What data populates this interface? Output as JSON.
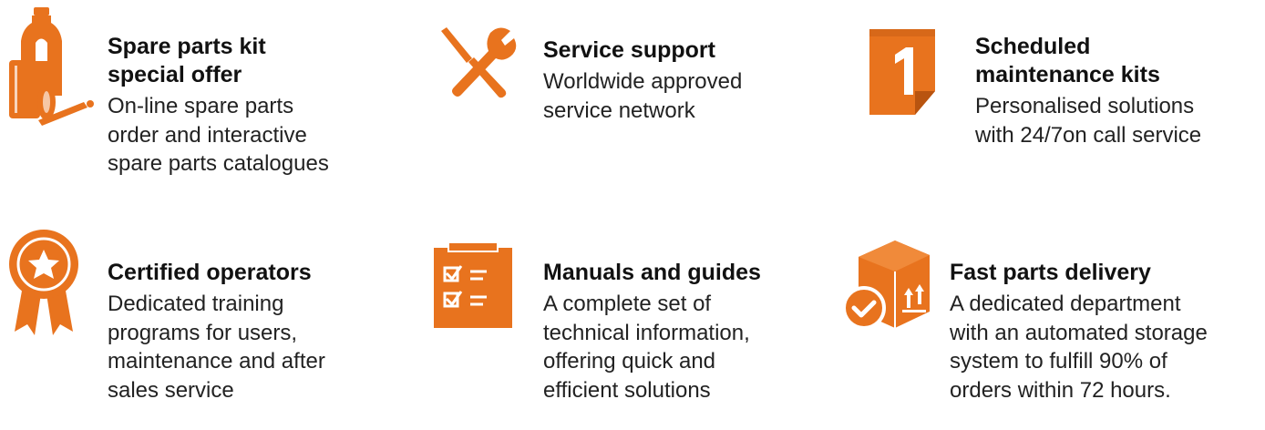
{
  "accent_color": "#E8731E",
  "features": [
    {
      "icon": "spare-parts-bottle-icon",
      "title": "Spare parts kit\nspecial offer",
      "description": "On-line spare parts\norder and interactive\nspare parts catalogues"
    },
    {
      "icon": "tools-icon",
      "title": "Service support",
      "description": "Worldwide approved\nservice network"
    },
    {
      "icon": "calendar-one-icon",
      "title": "Scheduled\nmaintenance kits",
      "description": "Personalised solutions\nwith 24/7on call service"
    },
    {
      "icon": "award-ribbon-icon",
      "title": "Certified operators",
      "description": "Dedicated training\nprograms for users,\nmaintenance and after\nsales service"
    },
    {
      "icon": "clipboard-checklist-icon",
      "title": "Manuals and guides",
      "description": "A complete set of\ntechnical information,\noffering quick and\nefficient solutions"
    },
    {
      "icon": "delivery-box-check-icon",
      "title": "Fast parts delivery",
      "description": "A dedicated department\nwith an automated storage\nsystem to fulfill 90% of\norders within 72 hours."
    }
  ]
}
